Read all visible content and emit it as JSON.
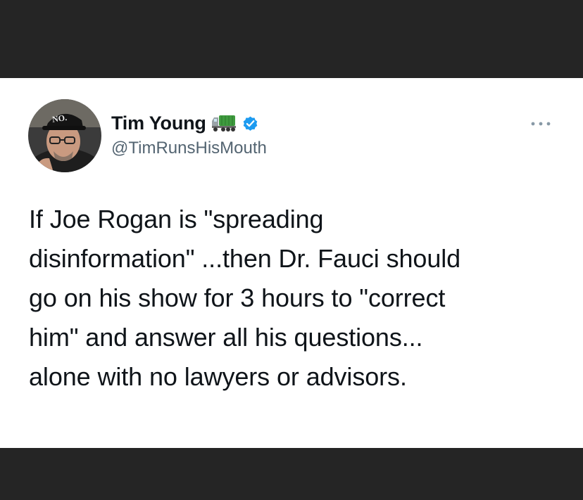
{
  "tweet": {
    "author": {
      "display_name": "Tim Young",
      "handle": "@TimRunsHisMouth",
      "name_emoji": "truck-icon",
      "verified": true,
      "avatar_hat_text": "NO."
    },
    "text": "If Joe Rogan is \"spreading\ndisinformation\" ...then Dr. Fauci should\ngo on his show for 3 hours to \"correct\nhim\" and answer all his questions...\nalone with no lawyers or advisors.",
    "more_options_icon": "more-options-icon"
  },
  "colors": {
    "card_background": "#ffffff",
    "frame_background": "#252525",
    "text_primary": "#0f1419",
    "text_secondary": "#536471",
    "verified_blue": "#1d9bf0"
  }
}
